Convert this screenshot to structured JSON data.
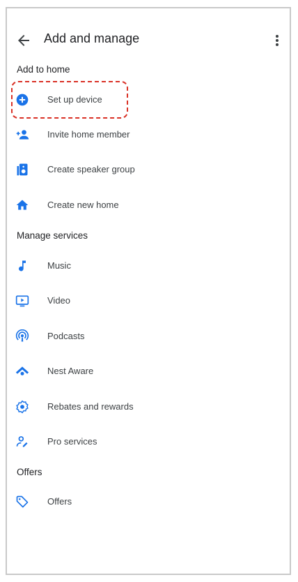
{
  "header": {
    "title": "Add and manage",
    "back_icon": "arrow-back-icon",
    "more_icon": "more-vert-icon"
  },
  "sections": {
    "add_to_home": "Add to home",
    "manage_services": "Manage services",
    "offers": "Offers"
  },
  "items": {
    "set_up_device": "Set up device",
    "invite_home_member": "Invite home member",
    "create_speaker_group": "Create speaker group",
    "create_new_home": "Create new home",
    "music": "Music",
    "video": "Video",
    "podcasts": "Podcasts",
    "nest_aware": "Nest Aware",
    "rebates_and_rewards": "Rebates and rewards",
    "pro_services": "Pro services",
    "offers": "Offers"
  },
  "colors": {
    "accent": "#1a73e8",
    "highlight": "#d93025"
  }
}
